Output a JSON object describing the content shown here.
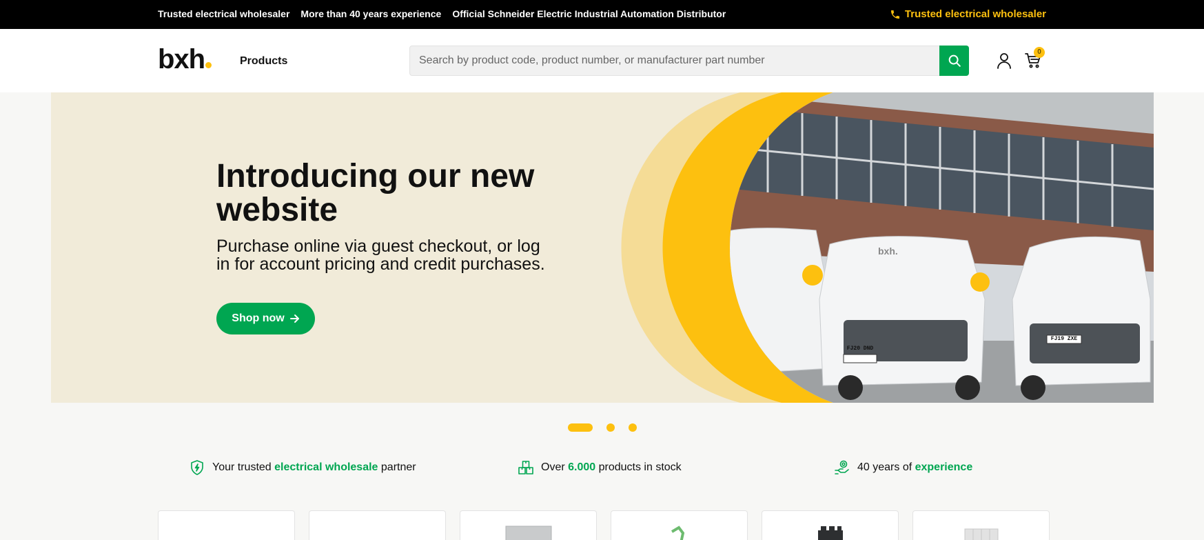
{
  "topbar": {
    "messages": [
      "Trusted electrical wholesaler",
      "More than 40 years experience",
      "Official Schneider Electric Industrial Automation Distributor"
    ],
    "phone_label": "Trusted electrical wholesaler",
    "phone_icon": "phone-icon"
  },
  "header": {
    "logo_text": "bxh",
    "nav_products": "Products",
    "search_placeholder": "Search by product code, product number, or manufacturer part number",
    "search_icon": "search-icon",
    "account_icon": "user-icon",
    "cart_icon": "cart-icon",
    "cart_count": "0"
  },
  "hero": {
    "title": "Introducing our new website",
    "subtitle": "Purchase online via guest checkout, or log in for account pricing and credit purchases.",
    "button_label": "Shop now",
    "van_plate_1": "FJ20 DND",
    "van_plate_2": "FJ19 ZXE",
    "van_logo": "bxh."
  },
  "carousel": {
    "slides": 3,
    "active": 1
  },
  "usps": [
    {
      "icon": "shield-bolt-icon",
      "pre": "Your trusted ",
      "highlight": "electrical wholesale",
      "post": " partner"
    },
    {
      "icon": "boxes-icon",
      "pre": "Over ",
      "highlight": "6.000",
      "post": " products in stock"
    },
    {
      "icon": "hand-award-icon",
      "pre": "40 years of ",
      "highlight": "experience",
      "post": ""
    }
  ],
  "colors": {
    "brand_yellow": "#fdc00f",
    "brand_green": "#00a651",
    "hero_bg": "#f1ebd9",
    "topbar_bg": "#000000"
  }
}
